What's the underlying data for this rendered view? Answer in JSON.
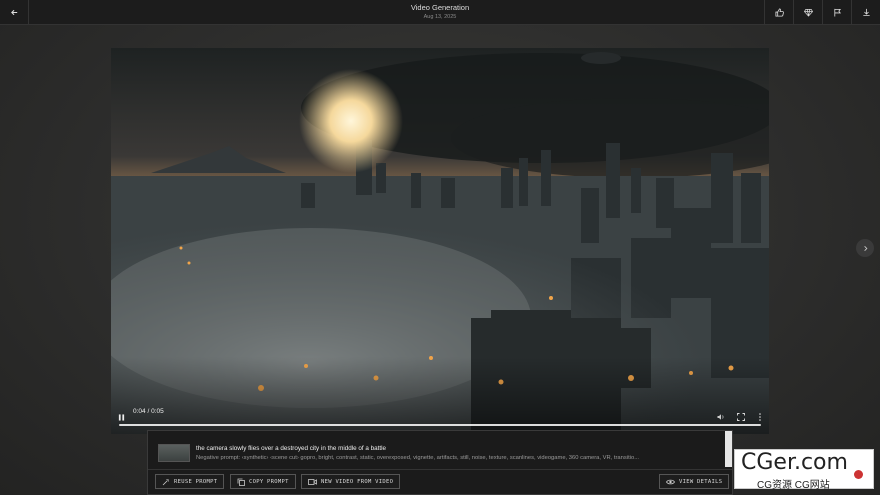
{
  "header": {
    "title": "Video Generation",
    "date": "Aug 13, 2025",
    "actions": [
      "thumbs-up-icon",
      "gem-icon",
      "flag-icon",
      "download-icon"
    ]
  },
  "player": {
    "time": "0:04 / 0:05",
    "progress": 1.0
  },
  "details": {
    "prompt": "the camera slowly flies over a destroyed city in the middle of a battle",
    "negative": "Negative prompt: ‹synthetic› ‹scene cut› gopro, bright, contrast, static, overexposed, vignette, artifacts, still, noise, texture, scanlines, videogame, 360 camera, VR, transitio..."
  },
  "buttons": {
    "reuse": "REUSE PROMPT",
    "copy": "COPY PROMPT",
    "new_video": "NEW VIDEO FROM VIDEO",
    "view_details": "VIEW DETAILS"
  },
  "watermark": {
    "big": "CGer.com",
    "small": "CG资源 CG网站"
  }
}
